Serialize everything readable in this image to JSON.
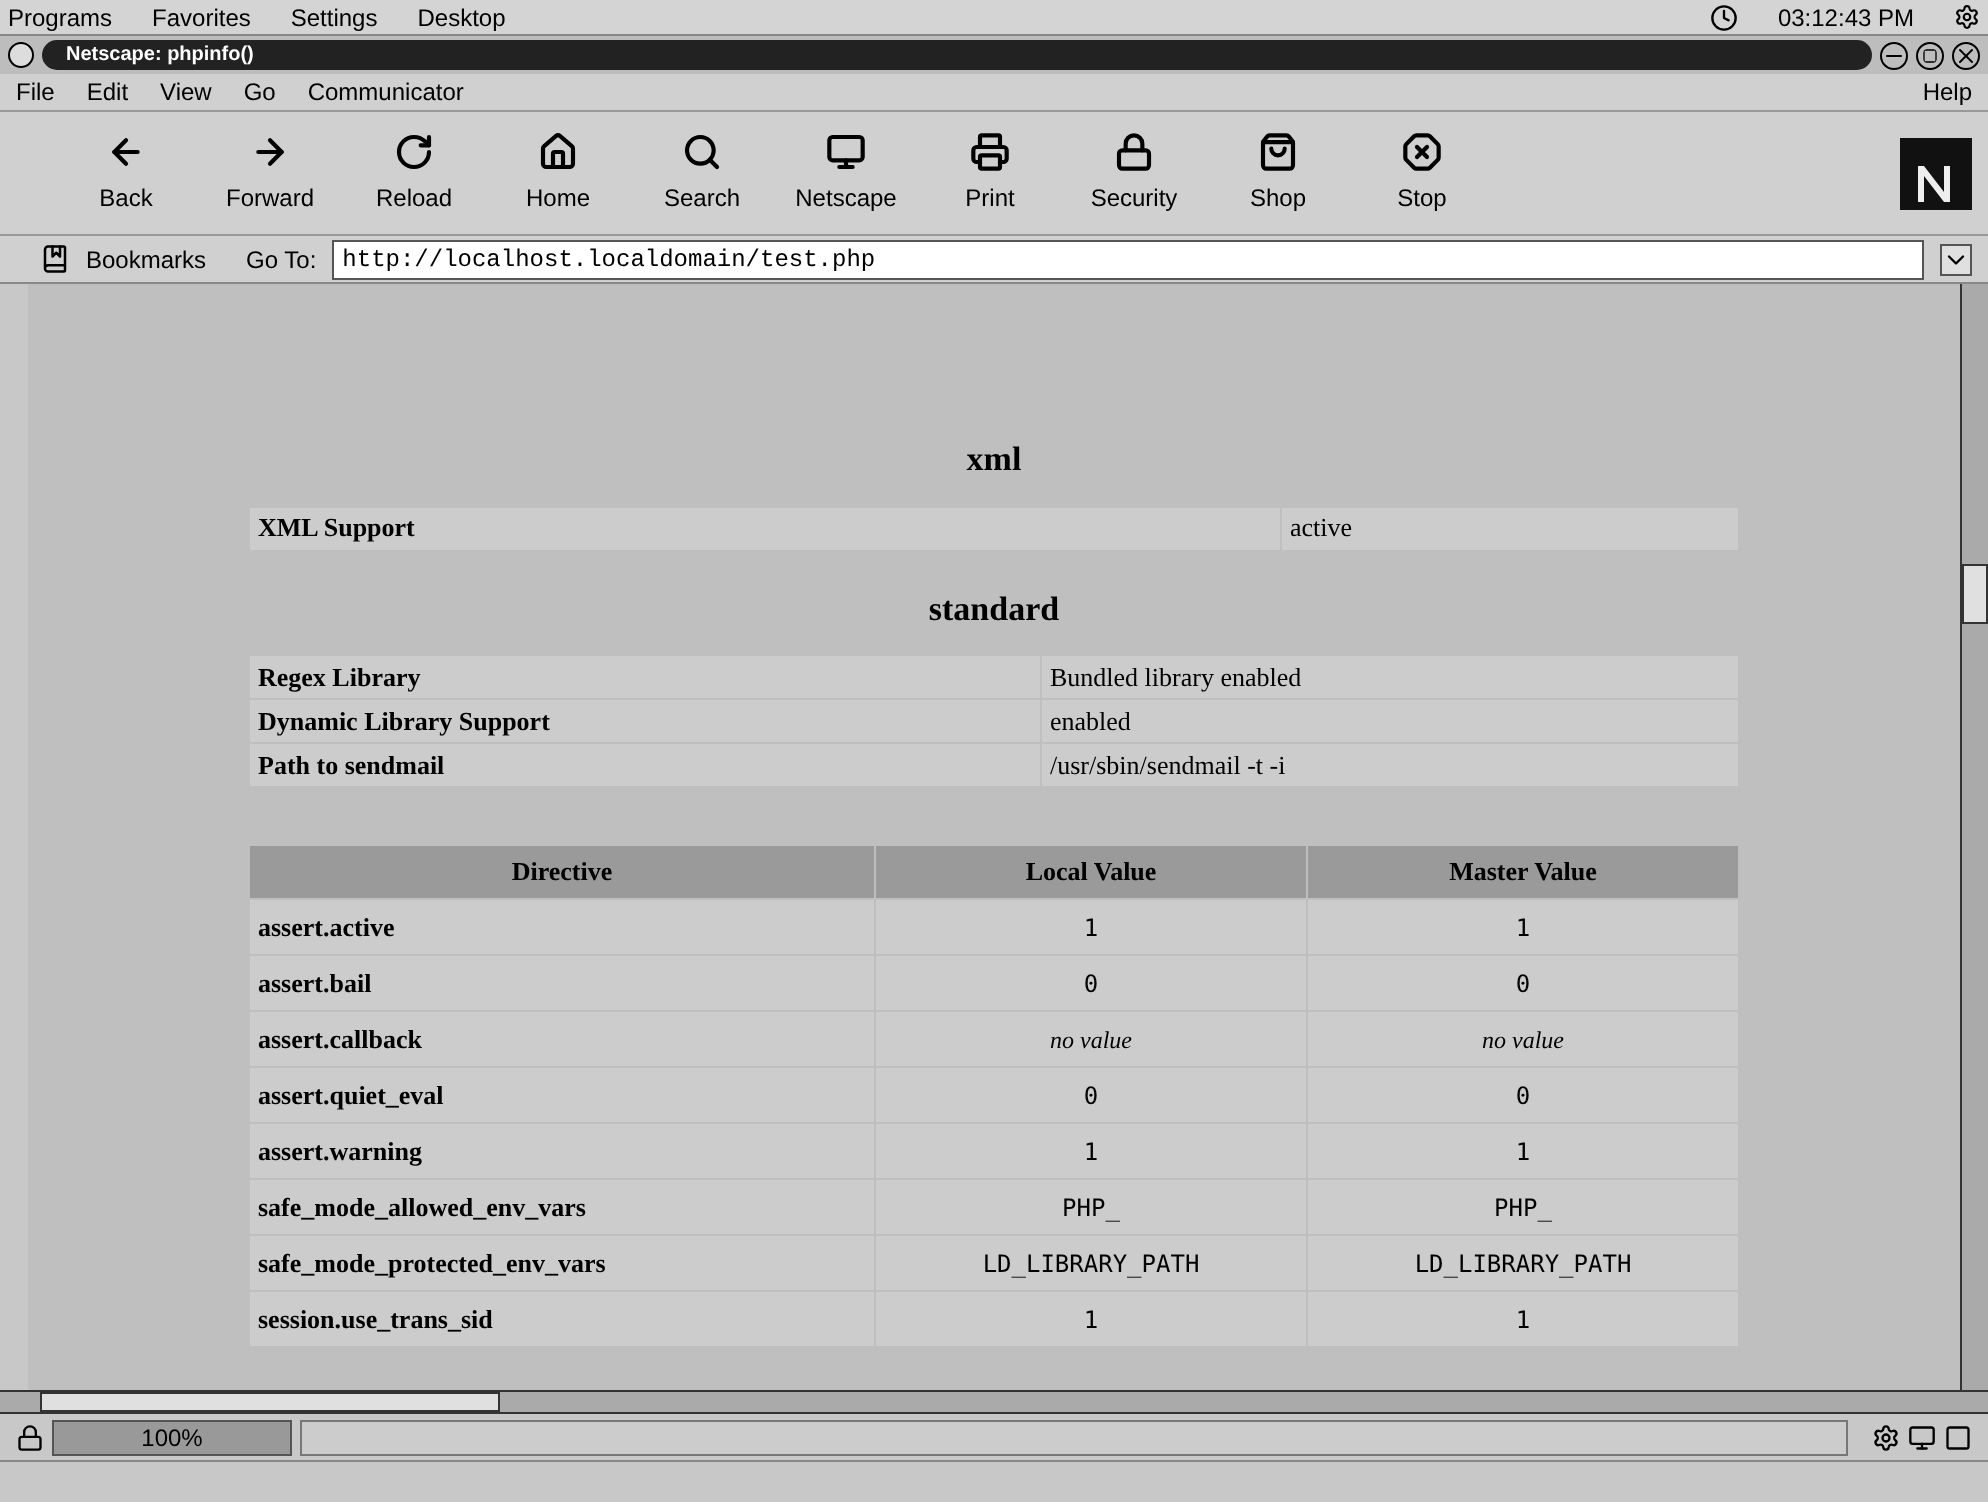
{
  "taskbar": {
    "menus": [
      "Programs",
      "Favorites",
      "Settings",
      "Desktop"
    ],
    "clock": "03:12:43 PM"
  },
  "window": {
    "title": "Netscape: phpinfo()"
  },
  "menu_bar": {
    "items": [
      "File",
      "Edit",
      "View",
      "Go",
      "Communicator"
    ],
    "help": "Help"
  },
  "toolbar": {
    "buttons": [
      {
        "label": "Back",
        "kind": "back"
      },
      {
        "label": "Forward",
        "kind": "forward"
      },
      {
        "label": "Reload",
        "kind": "reload"
      },
      {
        "label": "Home",
        "kind": "home"
      },
      {
        "label": "Search",
        "kind": "search"
      },
      {
        "label": "Netscape",
        "kind": "netscape"
      },
      {
        "label": "Print",
        "kind": "print"
      },
      {
        "label": "Security",
        "kind": "security"
      },
      {
        "label": "Shop",
        "kind": "shop"
      },
      {
        "label": "Stop",
        "kind": "stop"
      }
    ]
  },
  "location_bar": {
    "bookmarks": "Bookmarks",
    "goto_label": "Go To:",
    "url": "http://localhost.localdomain/test.php"
  },
  "content": {
    "sections": [
      {
        "heading": "xml",
        "rows": [
          [
            "XML Support",
            "active"
          ]
        ]
      },
      {
        "heading": "standard",
        "rows": [
          [
            "Regex Library",
            "Bundled library enabled"
          ],
          [
            "Dynamic Library Support",
            "enabled"
          ],
          [
            "Path to sendmail",
            "/usr/sbin/sendmail -t -i"
          ]
        ]
      }
    ],
    "directives": {
      "columns": [
        "Directive",
        "Local Value",
        "Master Value"
      ],
      "rows": [
        {
          "name": "assert.active",
          "local": "1",
          "master": "1",
          "kind": "plain"
        },
        {
          "name": "assert.bail",
          "local": "0",
          "master": "0",
          "kind": "plain"
        },
        {
          "name": "assert.callback",
          "local": "no value",
          "master": "no value",
          "kind": "novalue"
        },
        {
          "name": "assert.quiet_eval",
          "local": "0",
          "master": "0",
          "kind": "plain"
        },
        {
          "name": "assert.warning",
          "local": "1",
          "master": "1",
          "kind": "plain"
        },
        {
          "name": "safe_mode_allowed_env_vars",
          "local": "PHP_",
          "master": "PHP_",
          "kind": "mono"
        },
        {
          "name": "safe_mode_protected_env_vars",
          "local": "LD_LIBRARY_PATH",
          "master": "LD_LIBRARY_PATH",
          "kind": "mono"
        },
        {
          "name": "session.use_trans_sid",
          "local": "1",
          "master": "1",
          "kind": "plain"
        }
      ]
    }
  },
  "status_bar": {
    "zoom": "100%"
  }
}
